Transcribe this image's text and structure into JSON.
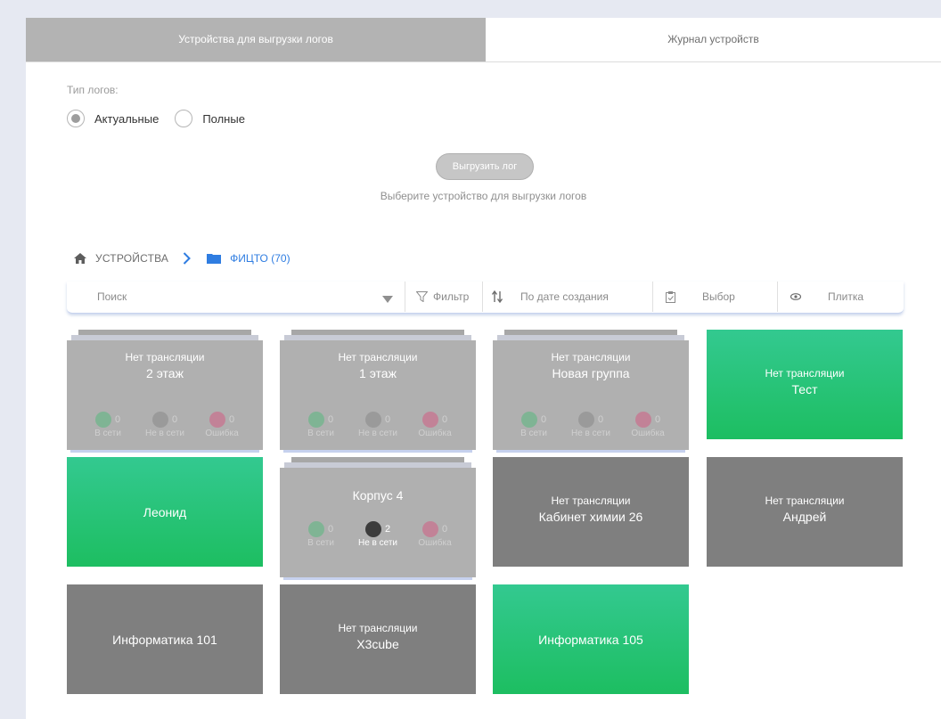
{
  "tabs": [
    {
      "label": "Устройства для выгрузки логов",
      "active": true
    },
    {
      "label": "Журнал устройств",
      "active": false
    }
  ],
  "log_type": {
    "label": "Тип логов:",
    "options": [
      {
        "label": "Актуальные",
        "checked": true
      },
      {
        "label": "Полные",
        "checked": false
      }
    ]
  },
  "export": {
    "button_label": "Выгрузить лог",
    "hint": "Выберите устройство для выгрузки логов"
  },
  "breadcrumb": {
    "home_icon": "home-icon",
    "root": "УСТРОЙСТВА",
    "separator_icon": "chevron-right-icon",
    "folder_icon": "folder-icon",
    "current": "ФИЦТО (70)"
  },
  "toolbar": {
    "search_placeholder": "Поиск",
    "filter_label": "Фильтр",
    "sort_label": "По дате создания",
    "select_label": "Выбор",
    "view_label": "Плитка"
  },
  "colors": {
    "accent": "#2f7de1",
    "online_green": "#1dbe61",
    "offline_gray": "#7f7f7f",
    "group_gray": "#b0b0b0"
  },
  "cards": [
    {
      "type": "group",
      "status": "Нет трансляции",
      "name": "2 этаж",
      "stats": [
        {
          "value": "0",
          "label": "В сети"
        },
        {
          "value": "0",
          "label": "Не в сети"
        },
        {
          "value": "0",
          "label": "Ошибка"
        }
      ]
    },
    {
      "type": "group",
      "status": "Нет трансляции",
      "name": "1 этаж",
      "stats": [
        {
          "value": "0",
          "label": "В сети"
        },
        {
          "value": "0",
          "label": "Не в сети"
        },
        {
          "value": "0",
          "label": "Ошибка"
        }
      ]
    },
    {
      "type": "group",
      "status": "Нет трансляции",
      "name": "Новая группа",
      "stats": [
        {
          "value": "0",
          "label": "В сети"
        },
        {
          "value": "0",
          "label": "Не в сети"
        },
        {
          "value": "0",
          "label": "Ошибка"
        }
      ]
    },
    {
      "type": "device",
      "color": "green",
      "status": "Нет трансляции",
      "name": "Тест"
    },
    {
      "type": "device",
      "color": "green",
      "status": "",
      "name": "Леонид"
    },
    {
      "type": "group",
      "status": "",
      "name": "Корпус 4",
      "stats": [
        {
          "value": "0",
          "label": "В сети"
        },
        {
          "value": "2",
          "label": "Не в сети"
        },
        {
          "value": "0",
          "label": "Ошибка"
        }
      ]
    },
    {
      "type": "device",
      "color": "dark",
      "status": "Нет трансляции",
      "name": "Кабинет химии 26"
    },
    {
      "type": "device",
      "color": "dark",
      "status": "Нет трансляции",
      "name": "Андрей"
    },
    {
      "type": "device",
      "color": "dark",
      "status": "",
      "name": "Информатика 101"
    },
    {
      "type": "device",
      "color": "dark",
      "status": "Нет трансляции",
      "name": "X3cube"
    },
    {
      "type": "device",
      "color": "green",
      "status": "",
      "name": "Информатика 105"
    }
  ]
}
